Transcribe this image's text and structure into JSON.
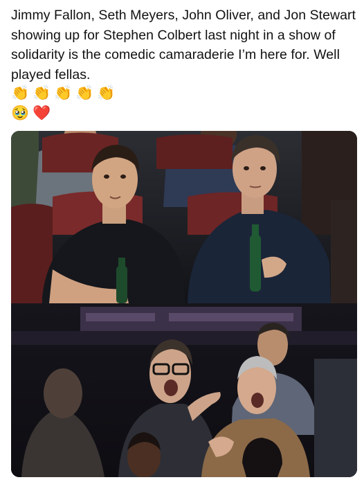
{
  "post": {
    "text": "Jimmy Fallon, Seth Meyers, John Oliver, and Jon Stewart showing up for Stephen Colbert last night in a show of solidarity is the comedic camaraderie I’m here for. Well played fellas.",
    "emoji_row1": [
      "👏",
      "👏",
      "👏",
      "👏",
      "👏"
    ],
    "emoji_row2": [
      "🥹",
      "❤️"
    ]
  },
  "media": {
    "top_photo": "audience-photo-fallon-meyers",
    "bottom_photo": "audience-photo-oliver-stewart"
  }
}
